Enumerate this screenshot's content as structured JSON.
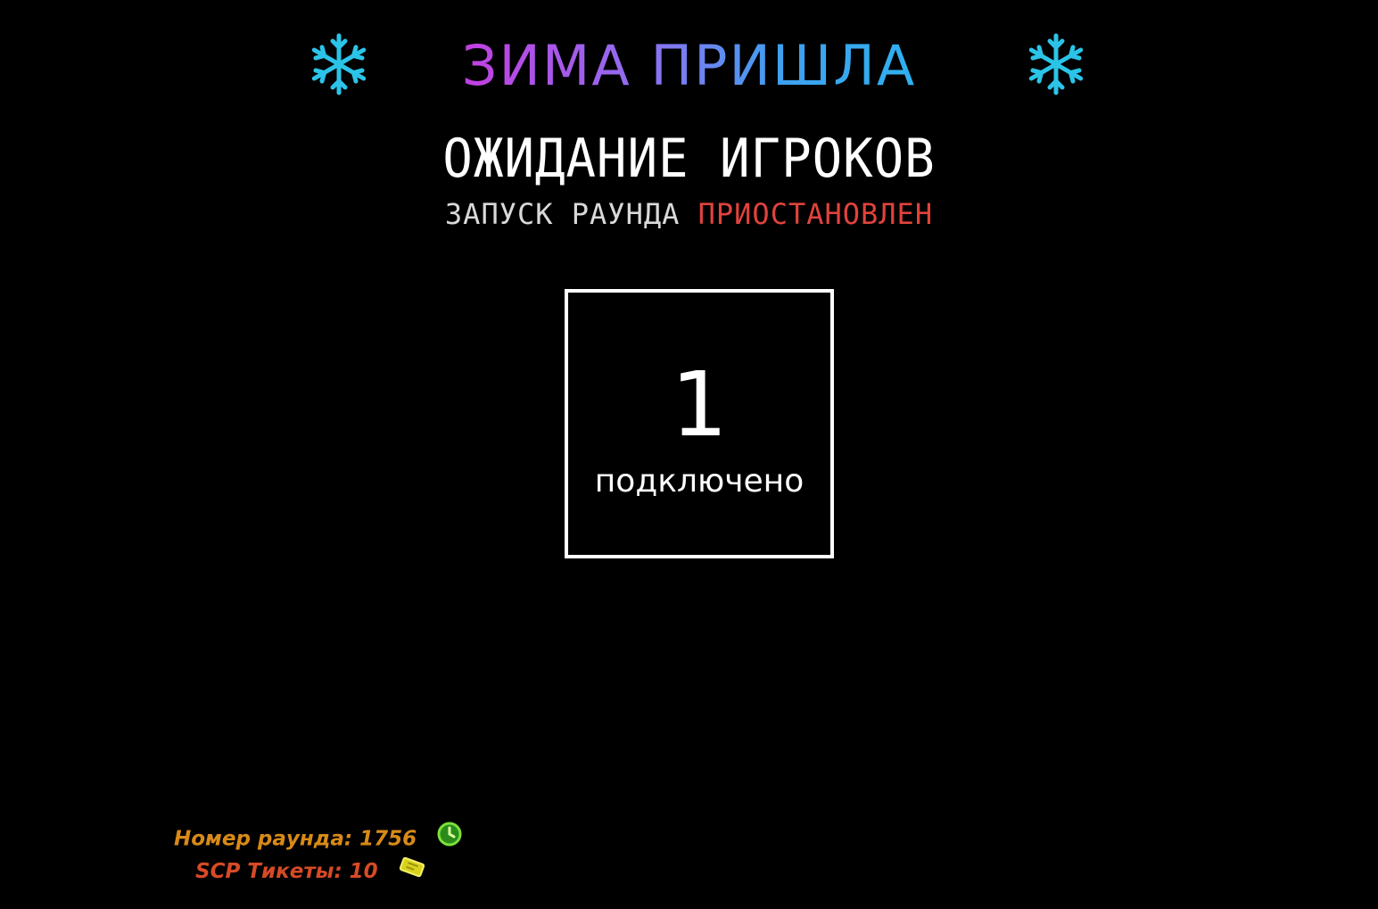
{
  "header": {
    "title": "ЗИМА ПРИШЛА",
    "left_icon": "snowflake-icon",
    "right_icon": "snowflake-icon",
    "snowflake_color": "#2bc4e8",
    "title_gradient": [
      "#c23fe0",
      "#3fa0f0"
    ]
  },
  "lobby": {
    "heading": "ОЖИДАНИЕ ИГРОКОВ",
    "status_prefix": "ЗАПУСК РАУНДА",
    "status_state": "ПРИОСТАНОВЛЕН",
    "status_state_color": "#e0433c"
  },
  "players": {
    "count": "1",
    "label": "подключено"
  },
  "footer": {
    "round_text": "Номер раунда: 1756",
    "round_icon": "clock-icon",
    "tickets_text": "SCP Тикеты: 10",
    "tickets_icon": "ticket-icon"
  }
}
